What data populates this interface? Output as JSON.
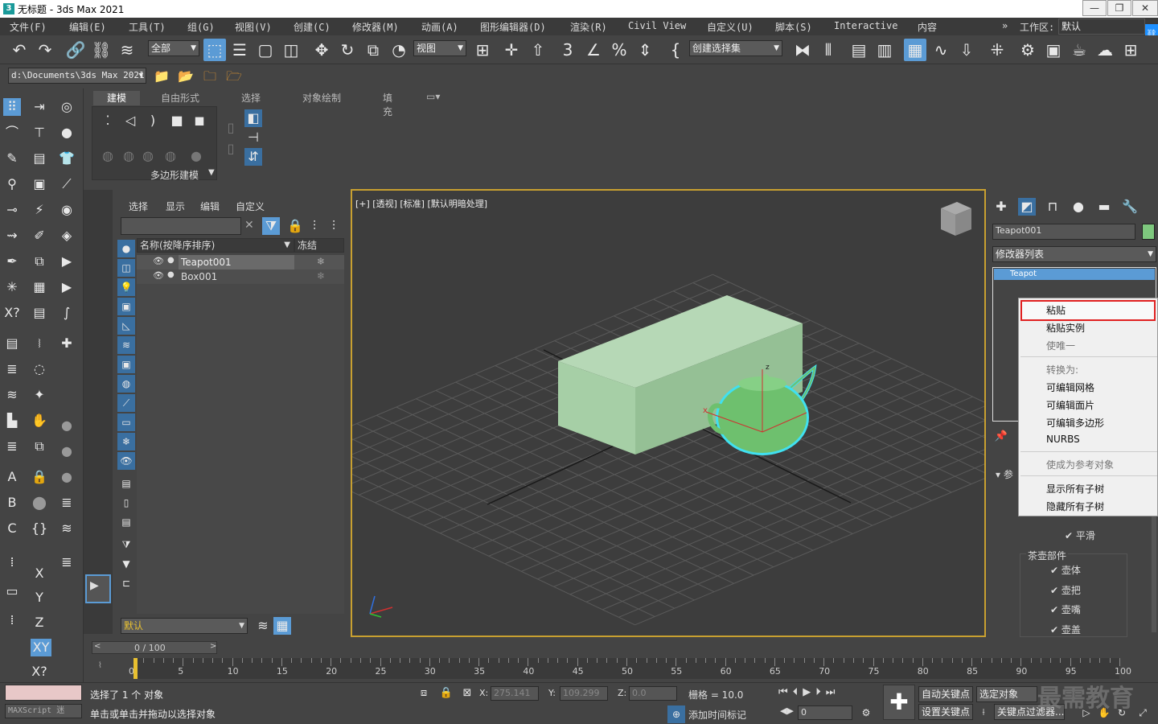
{
  "window": {
    "title": "无标题 - 3ds Max 2021",
    "minimize": "—",
    "maximize": "❐",
    "close": "✕"
  },
  "menu": [
    "文件(F)",
    "编辑(E)",
    "工具(T)",
    "组(G)",
    "视图(V)",
    "创建(C)",
    "修改器(M)",
    "动画(A)",
    "图形编辑器(D)",
    "渲染(R)",
    "Civil View",
    "自定义(U)",
    "脚本(S)",
    "Interactive",
    "内容"
  ],
  "workspace": {
    "label": "工作区:",
    "value": "默认"
  },
  "toolbar": {
    "selection_filter": "全部",
    "ref_coord": "视图",
    "named_selection": "创建选择集",
    "project_path": "d:\\Documents\\3ds Max 2021"
  },
  "ribbon": {
    "tabs": [
      "建模",
      "自由形式",
      "选择",
      "对象绘制",
      "填充"
    ],
    "panel_label": "多边形建模"
  },
  "scene_explorer": {
    "menu": [
      "选择",
      "显示",
      "编辑",
      "自定义"
    ],
    "col_name": "名称(按降序排序)",
    "col_freeze": "冻结",
    "rows": [
      {
        "name": "Teapot001"
      },
      {
        "name": "Box001"
      }
    ],
    "layer": "默认"
  },
  "viewport": {
    "label": "[+] [透视] [标准] [默认明暗处理]"
  },
  "command_panel": {
    "object_name": "Teapot001",
    "object_color": "#7ec87e",
    "modifier_list": "修改器列表",
    "stack_item": "Teapot",
    "params_rollout": "参",
    "smooth": "平滑",
    "teapot_parts": "茶壶部件",
    "parts": [
      "壶体",
      "壶把",
      "壶嘴",
      "壶盖"
    ]
  },
  "context_menu": {
    "paste": "粘贴",
    "paste_instance": "粘贴实例",
    "make_unique": "使唯一",
    "convert_to": "转换为:",
    "editable_mesh": "可编辑网格",
    "editable_patch": "可编辑面片",
    "editable_poly": "可编辑多边形",
    "nurbs": "NURBS",
    "make_reference": "使成为参考对象",
    "show_all": "显示所有子树",
    "hide_all": "隐藏所有子树"
  },
  "timeline": {
    "frame": "0 / 100",
    "ticks": [
      "0",
      "5",
      "10",
      "15",
      "20",
      "25",
      "30",
      "35",
      "40",
      "45",
      "50",
      "55",
      "60",
      "65",
      "70",
      "75",
      "80",
      "85",
      "90",
      "95",
      "100"
    ]
  },
  "status": {
    "maxscript": "MAXScript 迷",
    "selected": "选择了 1 个 对象",
    "prompt": "单击或单击并拖动以选择对象",
    "x_label": "X:",
    "x": "275.141",
    "y_label": "Y:",
    "y": "109.299",
    "z_label": "Z:",
    "z": "0.0",
    "grid": "栅格 = 10.0",
    "add_time_tag": "添加时间标记",
    "auto_key": "自动关键点",
    "selected_obj": "选定对象",
    "set_key": "设置关键点",
    "key_filters": "关键点过滤器...",
    "frame_value": "0",
    "watermark": "最需教育"
  },
  "colors": {
    "accent": "#5b9bd5",
    "highlight_red": "#e02020",
    "viewport_border": "#c8a030",
    "selection_cyan": "#40e0f0"
  }
}
